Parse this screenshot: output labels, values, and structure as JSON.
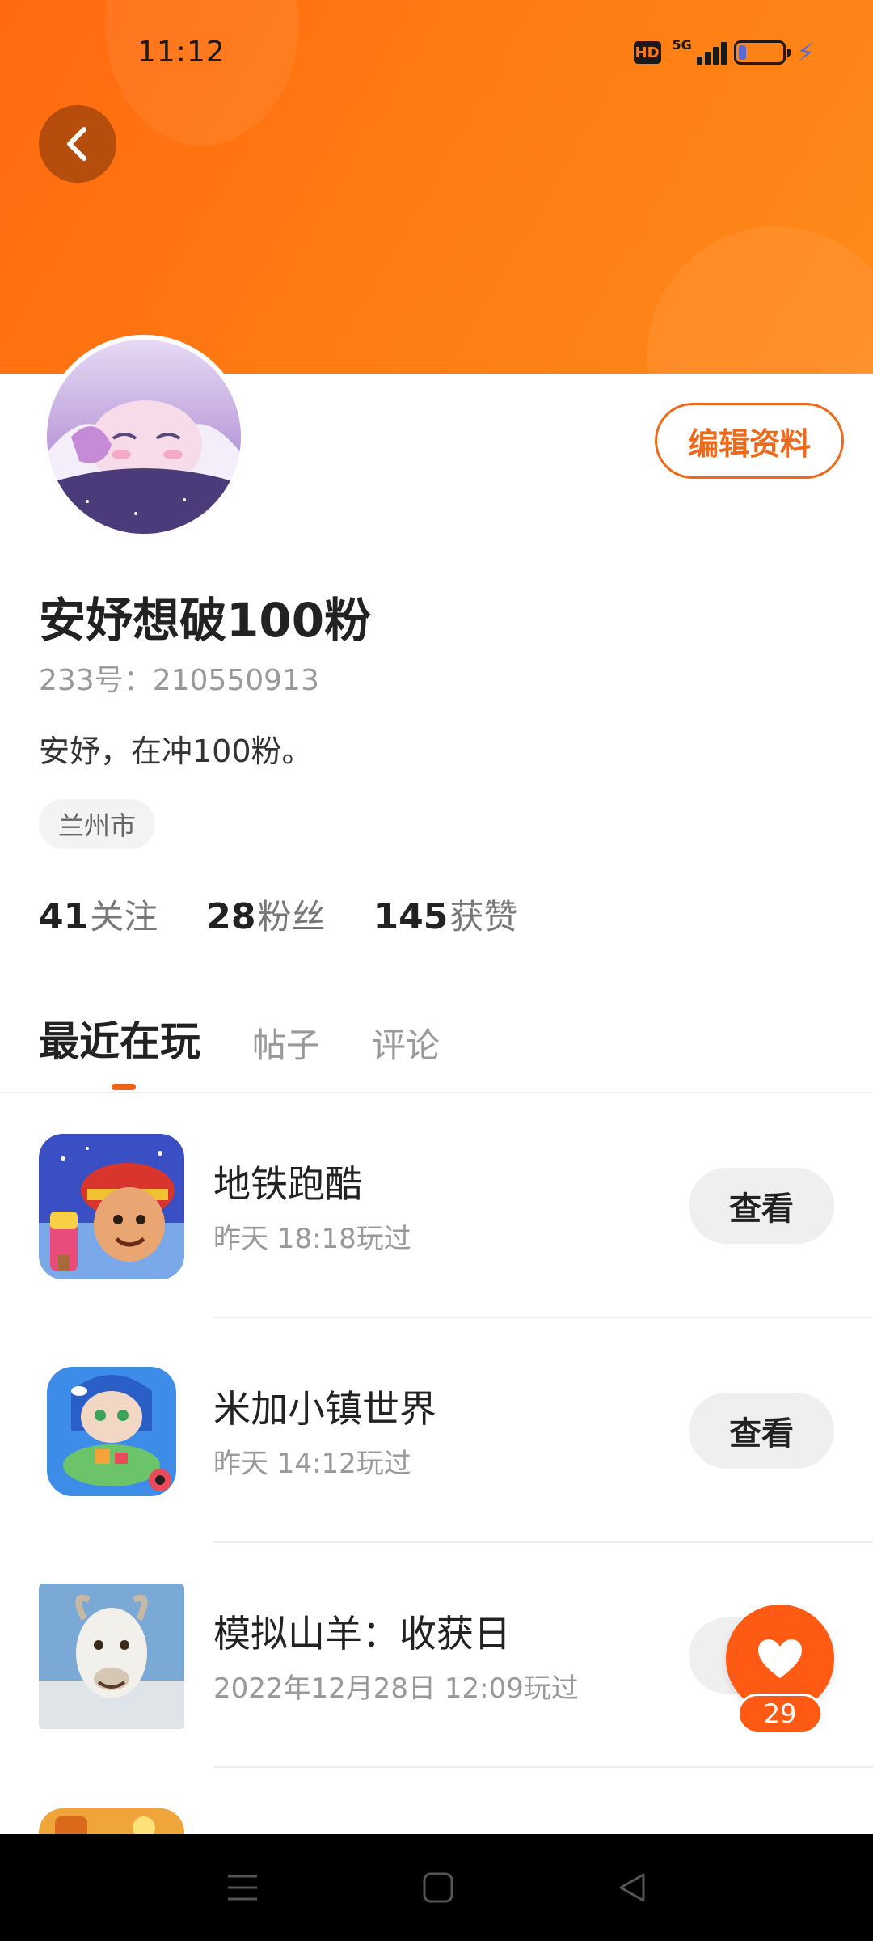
{
  "status_bar": {
    "time": "11:12",
    "hd_badge": "HD",
    "network": "5G",
    "battery_level": 0.15
  },
  "profile": {
    "edit_button": "编辑资料",
    "username": "安妤想破100粉",
    "user_id": "233号：210550913",
    "bio": "安妤，在冲100粉。",
    "location": "兰州市",
    "stats": [
      {
        "num": "41",
        "label": "关注"
      },
      {
        "num": "28",
        "label": "粉丝"
      },
      {
        "num": "145",
        "label": "获赞"
      }
    ]
  },
  "tabs": [
    {
      "label": "最近在玩",
      "active": true
    },
    {
      "label": "帖子",
      "active": false
    },
    {
      "label": "评论",
      "active": false
    }
  ],
  "games": [
    {
      "title": "地铁跑酷",
      "time": "昨天 18:18玩过",
      "button": "查看",
      "icon": "subway-surfers-icon"
    },
    {
      "title": "米加小镇世界",
      "time": "昨天 14:12玩过",
      "button": "查看",
      "icon": "miga-town-icon"
    },
    {
      "title": "模拟山羊：收获日",
      "time": "2022年12月28日 12:09玩过",
      "button": "查看",
      "icon": "goat-simulator-icon"
    }
  ],
  "like_fab": {
    "count": "29"
  },
  "colors": {
    "accent": "#ff6a10",
    "edit_border": "#ee6a1a",
    "nav_bar": "#000000"
  }
}
